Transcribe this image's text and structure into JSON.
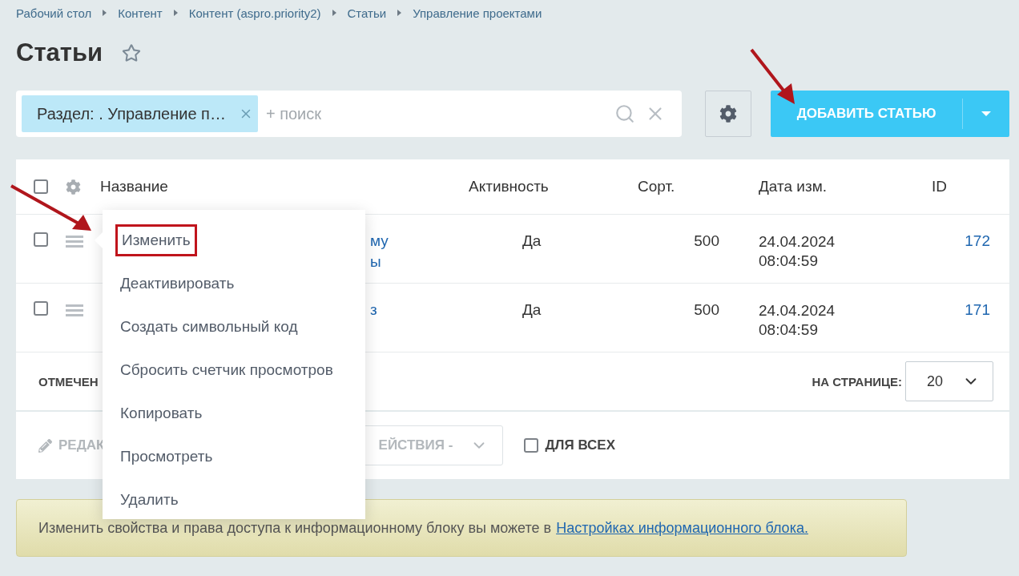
{
  "breadcrumbs": [
    "Рабочий стол",
    "Контент",
    "Контент (aspro.priority2)",
    "Статьи",
    "Управление проектами"
  ],
  "title": "Статьи",
  "favorite": false,
  "filter": {
    "tag": "Раздел: . Управление п…",
    "placeholder": "+ поиск"
  },
  "add_button": "ДОБАВИТЬ СТАТЬЮ",
  "table": {
    "all_checked": false,
    "columns": [
      "Название",
      "Активность",
      "Сорт.",
      "Дата изм.",
      "ID"
    ],
    "rows": [
      {
        "checked": false,
        "title_fragments": [
          "му",
          "ы"
        ],
        "active": "Да",
        "sort": "500",
        "date": [
          "24.04.2024",
          "08:04:59"
        ],
        "id": "172"
      },
      {
        "checked": false,
        "title_fragments": [
          "з"
        ],
        "active": "Да",
        "sort": "500",
        "date": [
          "24.04.2024",
          "08:04:59"
        ],
        "id": "171"
      }
    ]
  },
  "footer": {
    "marked": "ОТМЕЧЕН",
    "per_page_label": "НА СТРАНИЦЕ:",
    "per_page": "20"
  },
  "actions": {
    "edit": "РЕДАК",
    "select": "ЕЙСТВИЯ -",
    "for_all": {
      "label": "ДЛЯ ВСЕХ",
      "checked": false
    }
  },
  "context_menu": [
    {
      "label": "Изменить",
      "highlighted": true
    },
    {
      "label": "Деактивировать",
      "highlighted": false
    },
    {
      "label": "Создать символьный код",
      "highlighted": false
    },
    {
      "label": "Сбросить счетчик просмотров",
      "highlighted": false
    },
    {
      "label": "Копировать",
      "highlighted": false
    },
    {
      "label": "Просмотреть",
      "highlighted": false
    },
    {
      "label": "Удалить",
      "highlighted": false
    }
  ],
  "notice": {
    "text": "Изменить свойства и права доступа к информационному блоку вы можете в",
    "link": "Настройках информационного блока."
  }
}
